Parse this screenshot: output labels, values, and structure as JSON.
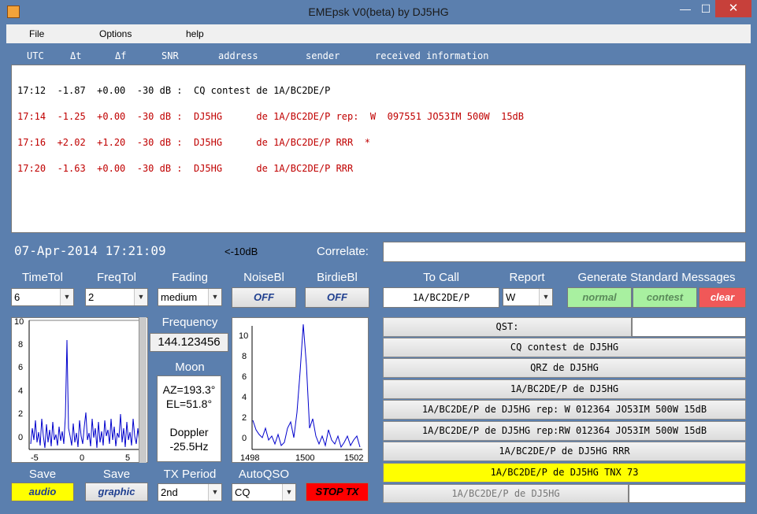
{
  "window": {
    "title": "EMEpsk V0(beta) by DJ5HG",
    "minimize": "—",
    "maximize": "☐",
    "close": "✕"
  },
  "menu": {
    "file": "File",
    "options": "Options",
    "help": "help"
  },
  "log": {
    "headers": [
      "UTC",
      "Δt",
      "Δf",
      "SNR",
      "address",
      "sender",
      "received information"
    ],
    "rows": [
      {
        "text": "17:12  -1.87  +0.00  -30 dB :  CQ contest de 1A/BC2DE/P",
        "color": "#000000"
      },
      {
        "text": "17:14  -1.25  +0.00  -30 dB :  DJ5HG      de 1A/BC2DE/P rep:  W  097551 JO53IM 500W  15dB",
        "color": "#c00000"
      },
      {
        "text": "17:16  +2.02  +1.20  -30 dB :  DJ5HG      de 1A/BC2DE/P RRR  *",
        "color": "#c00000"
      },
      {
        "text": "17:20  -1.63  +0.00  -30 dB :  DJ5HG      de 1A/BC2DE/P RRR",
        "color": "#c00000"
      }
    ]
  },
  "status": {
    "datetime": "07-Apr-2014 17:21:09",
    "level": "<-10dB",
    "correlate_label": "Correlate:",
    "correlate_value": ""
  },
  "controls": {
    "timetol_label": "TimeTol",
    "timetol_value": "6",
    "freqtol_label": "FreqTol",
    "freqtol_value": "2",
    "fading_label": "Fading",
    "fading_value": "medium",
    "noisebl_label": "NoiseBl",
    "noisebl_value": "OFF",
    "birdiebl_label": "BirdieBl",
    "birdiebl_value": "OFF",
    "tocall_label": "To Call",
    "tocall_value": "1A/BC2DE/P",
    "report_label": "Report",
    "report_value": "W",
    "gen_label": "Generate Standard Messages",
    "normal": "normal",
    "contest": "contest",
    "clear": "clear"
  },
  "frequency": {
    "label": "Frequency",
    "value": "144.123456"
  },
  "moon": {
    "label": "Moon",
    "az": "AZ=193.3°",
    "el": "EL=51.8°",
    "doppler_label": "Doppler",
    "doppler_value": "-25.5Hz"
  },
  "plot1": {
    "y_ticks": [
      "10",
      "8",
      "6",
      "4",
      "2",
      "0"
    ],
    "x_ticks": [
      "-5",
      "0",
      "5"
    ]
  },
  "plot2": {
    "y_ticks": [
      "10",
      "8",
      "6",
      "4",
      "2",
      "0"
    ],
    "x_ticks": [
      "1498",
      "1500",
      "1502"
    ]
  },
  "messages": {
    "qst": "QST:",
    "qst_value": "",
    "list": [
      "CQ contest de DJ5HG",
      "QRZ de DJ5HG",
      "1A/BC2DE/P de DJ5HG",
      "1A/BC2DE/P de DJ5HG rep: W  012364 JO53IM  500W  15dB",
      "1A/BC2DE/P de DJ5HG rep:RW  012364 JO53IM  500W  15dB",
      "1A/BC2DE/P de DJ5HG RRR",
      "1A/BC2DE/P de DJ5HG TNX 73"
    ],
    "tx_current": "1A/BC2DE/P de DJ5HG",
    "tx_extra": ""
  },
  "bottom": {
    "save1_label": "Save",
    "audio": "audio",
    "save2_label": "Save",
    "graphic": "graphic",
    "txperiod_label": "TX Period",
    "txperiod_value": "2nd",
    "autoqso_label": "AutoQSO",
    "autoqso_value": "CQ",
    "stoptx": "STOP TX"
  },
  "colors": {
    "yellow": "#ffff00",
    "green": "#a8f0a0",
    "red": "#f05858",
    "stop": "#ff0000",
    "plot_line": "#0000cc"
  }
}
